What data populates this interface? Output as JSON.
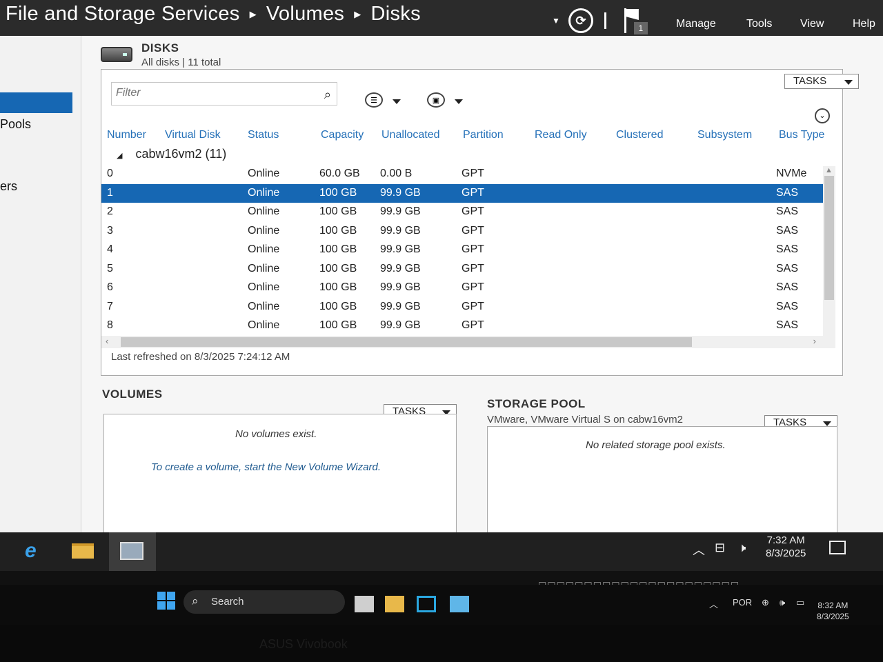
{
  "header": {
    "breadcrumb": [
      "File and Storage Services",
      "Volumes",
      "Disks"
    ],
    "notification_count": "1",
    "menu": [
      "Manage",
      "Tools",
      "View",
      "Help"
    ]
  },
  "left_nav": {
    "items": [
      "Pools",
      "ers"
    ]
  },
  "disks": {
    "title": "DISKS",
    "subtitle": "All disks | 11 total",
    "tasks_label": "TASKS",
    "filter_placeholder": "Filter",
    "columns": [
      "Number",
      "Virtual Disk",
      "Status",
      "Capacity",
      "Unallocated",
      "Partition",
      "Read Only",
      "Clustered",
      "Subsystem",
      "Bus Type"
    ],
    "group_label": "cabw16vm2 (11)",
    "rows": [
      {
        "number": "0",
        "status": "Online",
        "capacity": "60.0 GB",
        "unallocated": "0.00 B",
        "partition": "GPT",
        "bus": "NVMe"
      },
      {
        "number": "1",
        "status": "Online",
        "capacity": "100 GB",
        "unallocated": "99.9 GB",
        "partition": "GPT",
        "bus": "SAS"
      },
      {
        "number": "2",
        "status": "Online",
        "capacity": "100 GB",
        "unallocated": "99.9 GB",
        "partition": "GPT",
        "bus": "SAS"
      },
      {
        "number": "3",
        "status": "Online",
        "capacity": "100 GB",
        "unallocated": "99.9 GB",
        "partition": "GPT",
        "bus": "SAS"
      },
      {
        "number": "4",
        "status": "Online",
        "capacity": "100 GB",
        "unallocated": "99.9 GB",
        "partition": "GPT",
        "bus": "SAS"
      },
      {
        "number": "5",
        "status": "Online",
        "capacity": "100 GB",
        "unallocated": "99.9 GB",
        "partition": "GPT",
        "bus": "SAS"
      },
      {
        "number": "6",
        "status": "Online",
        "capacity": "100 GB",
        "unallocated": "99.9 GB",
        "partition": "GPT",
        "bus": "SAS"
      },
      {
        "number": "7",
        "status": "Online",
        "capacity": "100 GB",
        "unallocated": "99.9 GB",
        "partition": "GPT",
        "bus": "SAS"
      },
      {
        "number": "8",
        "status": "Online",
        "capacity": "100 GB",
        "unallocated": "99.9 GB",
        "partition": "GPT",
        "bus": "SAS"
      }
    ],
    "selected_row_index": 1,
    "last_refreshed": "Last refreshed on 8/3/2025 7:24:12 AM"
  },
  "volumes": {
    "title": "VOLUMES",
    "tasks_label": "TASKS",
    "empty_message": "No volumes exist.",
    "hint": "To create a volume, start the New Volume Wizard."
  },
  "storage_pool": {
    "title": "STORAGE POOL",
    "subtitle": "VMware, VMware Virtual S on cabw16vm2",
    "tasks_label": "TASKS",
    "empty_message": "No related storage pool exists."
  },
  "server_taskbar": {
    "time": "7:32 AM",
    "date": "8/3/2025"
  },
  "host_taskbar": {
    "search_label": "Search",
    "language": "POR",
    "time": "8:32 AM",
    "date": "8/3/2025",
    "brand": "ASUS Vivobook"
  },
  "colors": {
    "selection": "#1667b3",
    "header_bg": "#2b2b2b",
    "column_header": "#2470b8"
  }
}
